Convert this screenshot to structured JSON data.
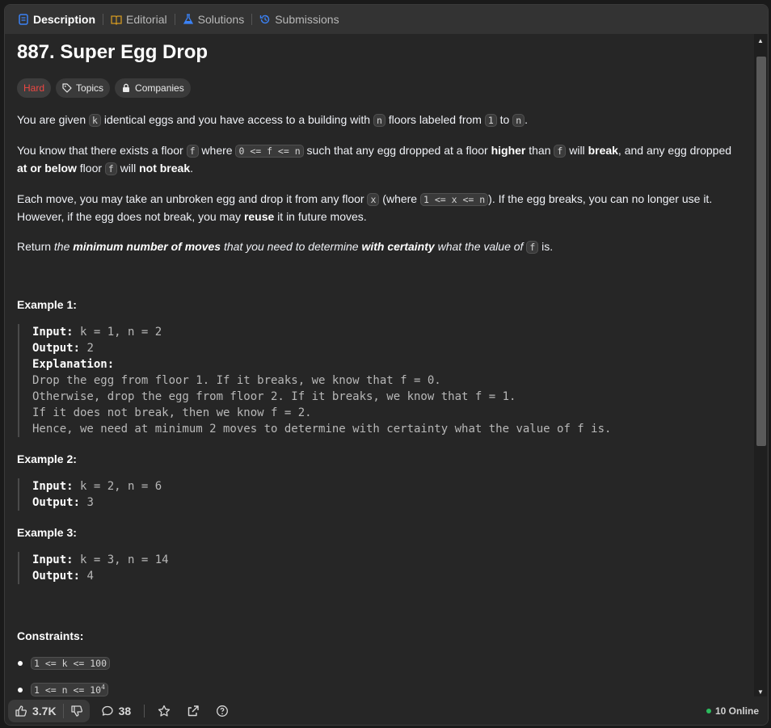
{
  "tabs": [
    {
      "label": "Description",
      "icon": "description-icon",
      "active": true
    },
    {
      "label": "Editorial",
      "icon": "book-icon"
    },
    {
      "label": "Solutions",
      "icon": "flask-icon"
    },
    {
      "label": "Submissions",
      "icon": "history-icon"
    }
  ],
  "problem": {
    "title": "887. Super Egg Drop",
    "difficulty": "Hard",
    "topics_label": "Topics",
    "companies_label": "Companies"
  },
  "description": {
    "p1": {
      "a": "You are given ",
      "k": "k",
      "b": " identical eggs and you have access to a building with ",
      "n": "n",
      "c": " floors labeled from ",
      "one": "1",
      "d": " to ",
      "n2": "n",
      "e": "."
    },
    "p2": {
      "a": "You know that there exists a floor ",
      "f": "f",
      "b": " where ",
      "cond": "0 <= f <= n",
      "c": " such that any egg dropped at a floor ",
      "higher": "higher",
      "d": " than ",
      "f2": "f",
      "e": " will ",
      "brk": "break",
      "g": ", and any egg dropped ",
      "atbelow": "at or below",
      "h": " floor ",
      "f3": "f",
      "i": " will ",
      "notbreak": "not break",
      "j": "."
    },
    "p3": {
      "a": "Each move, you may take an unbroken egg and drop it from any floor ",
      "x": "x",
      "b": " (where ",
      "cond": "1 <= x <= n",
      "c": "). If the egg breaks, you can no longer use it. However, if the egg does not break, you may ",
      "reuse": "reuse",
      "d": " it in future moves."
    },
    "p4": {
      "a": "Return ",
      "b": "the ",
      "minmoves": "minimum number of moves",
      "c": " that you need to determine ",
      "cert": "with certainty",
      "d": " what the value of ",
      "f": "f",
      "e": " is."
    }
  },
  "examples": [
    {
      "heading": "Example 1:",
      "input_label": "Input:",
      "input": " k = 1, n = 2",
      "output_label": "Output:",
      "output": " 2",
      "explanation_label": "Explanation:",
      "explanation": [
        "Drop the egg from floor 1. If it breaks, we know that f = 0.",
        "Otherwise, drop the egg from floor 2. If it breaks, we know that f = 1.",
        "If it does not break, then we know f = 2.",
        "Hence, we need at minimum 2 moves to determine with certainty what the value of f is."
      ]
    },
    {
      "heading": "Example 2:",
      "input_label": "Input:",
      "input": " k = 2, n = 6",
      "output_label": "Output:",
      "output": " 3"
    },
    {
      "heading": "Example 3:",
      "input_label": "Input:",
      "input": " k = 3, n = 14",
      "output_label": "Output:",
      "output": " 4"
    }
  ],
  "constraints": {
    "heading": "Constraints:",
    "items": [
      "1 <= k <= 100",
      "1 <= n <= 10"
    ],
    "exponent": "4"
  },
  "footer": {
    "likes": "3.7K",
    "comments": "38",
    "online": "10 Online"
  },
  "colors": {
    "hard": "#ef4743",
    "online_dot": "#2cbb5d",
    "active_tab_icon": "#3b82f6"
  }
}
